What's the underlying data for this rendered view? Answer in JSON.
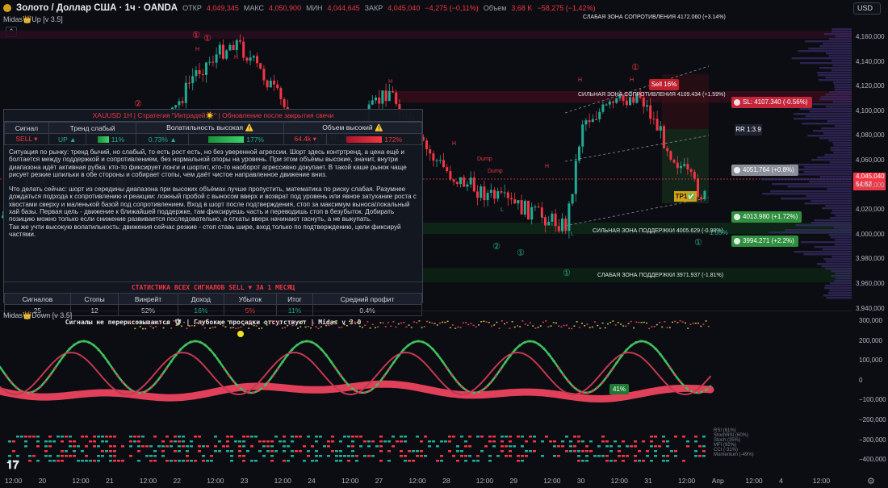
{
  "header": {
    "title": "Золото / Доллар США · 1ч · OANDA",
    "open_label": "ОТКР",
    "open": "4,049,345",
    "high_label": "МАКС",
    "high": "4,050,900",
    "low_label": "МИН",
    "low": "4,044,645",
    "close_label": "ЗАКР",
    "close": "4,045,040",
    "change": "−4,275 (−0,11%)",
    "volume_label": "Объем",
    "volume": "3,68 K",
    "volume_change": "−58,275 (−1,42%)",
    "currency": "USD"
  },
  "indicator_top": "Midas👑Up [v 3.5]",
  "indicator_bottom": "Midas👑Down [v 3.5]",
  "price_scale": [
    "4,160,000",
    "4,140,000",
    "4,120,000",
    "4,100,000",
    "4,080,000",
    "4,060,000",
    "4,040,000",
    "4,020,000",
    "4,000,000",
    "3,980,000",
    "3,960,000",
    "3,940,000"
  ],
  "last_price": {
    "value": "4,045,040",
    "countdown": "54:57"
  },
  "zones": {
    "weak_resistance": "СЛАБАЯ ЗОНА СОПРОТИВЛЕНИЯ 4172.060 (+3.14%)",
    "strong_resistance": "СИЛЬНАЯ ЗОНА СОПРОТИВЛЕНИЯ 4109.434 (+1.59%)",
    "strong_support": "СИЛЬНАЯ ЗОНА ПОДДЕРЖКИ 4005.629 (-0.98%)",
    "weak_support": "СЛАБАЯ ЗОНА ПОДДЕРЖКИ 3971.937 (-1.81%)"
  },
  "tags": {
    "sl": "SL: 4107.340 (-0.56%)",
    "entry": "4051.764 (+0.8%)",
    "tp1": "4013.980 (+1.72%)",
    "tp2": "3994.271 (+2.2%)",
    "rr": "RR 1:3.9",
    "sell": "Sell 16%",
    "tp1_hit": "TP1✅",
    "support_pct": "1.55%",
    "dump1": "Dump",
    "dump2": "Dump",
    "osc_pct": "41%"
  },
  "panel": {
    "title": "XAUUSD 1H | Стратегия \"Интрадей☀️\" | Обновление после закрытия свечи",
    "headers": [
      "Сигнал",
      "Тренд слабый",
      "Волатильность высокая ⚠️",
      "Объем высокий ⚠️"
    ],
    "row": {
      "signal": "SELL ▾",
      "trend": "UP ▲",
      "trend_pct": "11%",
      "vol_val": "0.73% ▲",
      "vol_pct": "177%",
      "volume_val": "64.4k ▾",
      "volume_pct": "172%"
    },
    "text1": "Ситуация по рынку: тренд бычий, но слабый, то есть рост есть, но без уверенной агрессии. Шорт здесь контртренд, а цена ещё и болтается между поддержкой и сопротивлением, без нормальной опоры на уровень. При этом объёмы высокие, значит, внутри диапазона идёт активная рубка: кто-то фиксирует лонги и шортит, кто-то наоборот агрессивно докупает. В такой каше рынок чаще рисует резкие шпильки в обе стороны и собирает стопы, чем даёт чистое направленное движение вниз.",
    "text2": "Что делать сейчас: шорт из середины диапазона при высоких объёмах лучше пропустить, математика по риску слабая. Разумнее дождаться подхода к сопротивлению и реакции: ложный пробой с выносом вверх и возврат под уровень или явное затухание роста с хвостами сверху и маленькой базой под сопротивлением. Вход в шорт после подтверждения, стоп за максимум выноса/локальный хай базы. Первая цель - движение к ближайшей поддержке, там фиксируешь часть и переводишь стоп в безубыток. Добирать позицию можно только если снижение развивается последовательно, а откаты вверх начинают гаснуть, а не выкупать.",
    "text3": "Так же учти высокую волатильность: движения сейчас резкие - стоп ставь шире, вход только по подтверждению, цели фиксируй частями.",
    "stats_title": "СТАТИСТИКА ВСЕХ СИГНАЛОВ SELL ▼ ЗА 1 МЕСЯЦ",
    "stats_headers": [
      "Сигналов",
      "Стопы",
      "Винрейт",
      "Доход",
      "Убыток",
      "Итог",
      "Средний профит"
    ],
    "stats_values": [
      "25",
      "12",
      "52%",
      "16%",
      "5%",
      "11%",
      "0.4%"
    ],
    "footer": "Сигналы не перерисовываются 🛡 | Глубокие просадки отсутствуют | Midas v 3.0"
  },
  "osc_scale": [
    "300,000",
    "200,000",
    "100,000",
    "0",
    "−100,000",
    "−200,000",
    "−300,000",
    "−400,000"
  ],
  "osc_legend": [
    "RSI (61%)",
    "StochRSI (60%)",
    "Stoch (35%)",
    "MFI (92%)",
    "CCI (-31%)",
    "Momentum (-49%)"
  ],
  "time_axis": [
    "12:00",
    "20",
    "12:00",
    "21",
    "12:00",
    "22",
    "12:00",
    "23",
    "12:00",
    "24",
    "12:00",
    "27",
    "12:00",
    "28",
    "12:00",
    "29",
    "12:00",
    "30",
    "12:00",
    "31",
    "12:00",
    "Апр",
    "12:00",
    "4",
    "12:00"
  ],
  "markers": {
    "h": "H",
    "l": "L",
    "circled_one": "①",
    "circled_two": "②"
  }
}
